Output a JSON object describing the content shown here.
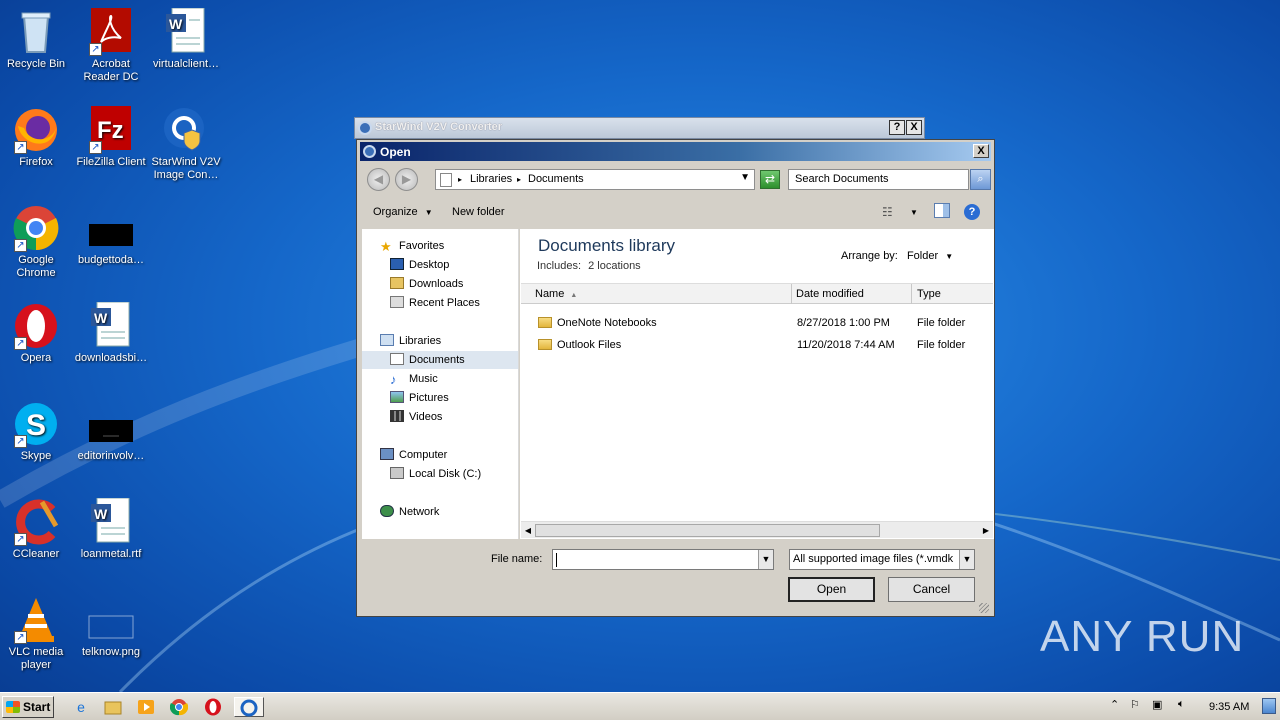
{
  "desktop": {
    "icons": [
      {
        "label": "Recycle Bin",
        "icon": "recycle-bin-icon"
      },
      {
        "label": "Acrobat Reader DC",
        "icon": "acrobat-icon"
      },
      {
        "label": "virtualclient…",
        "icon": "word-doc-icon"
      },
      {
        "label": "Firefox",
        "icon": "firefox-icon"
      },
      {
        "label": "FileZilla Client",
        "icon": "filezilla-icon"
      },
      {
        "label": "StarWind V2V Image Con…",
        "icon": "starwind-icon"
      },
      {
        "label": "Google Chrome",
        "icon": "chrome-icon"
      },
      {
        "label": "budgettoda…",
        "icon": "black-file-icon"
      },
      {
        "label": "Opera",
        "icon": "opera-icon"
      },
      {
        "label": "downloadsbi…",
        "icon": "word-doc-icon"
      },
      {
        "label": "Skype",
        "icon": "skype-icon"
      },
      {
        "label": "editorinvolv…",
        "icon": "black-file-icon"
      },
      {
        "label": "CCleaner",
        "icon": "ccleaner-icon"
      },
      {
        "label": "loanmetal.rtf",
        "icon": "word-doc-icon"
      },
      {
        "label": "VLC media player",
        "icon": "vlc-icon"
      },
      {
        "label": "telknow.png",
        "icon": "png-file-icon"
      }
    ]
  },
  "v2v_window": {
    "title": "StarWind V2V Converter",
    "help_btn": "?",
    "close_btn": "X"
  },
  "dialog": {
    "title": "Open",
    "close_btn": "X",
    "address": {
      "crumbs": [
        "Libraries",
        "Documents"
      ]
    },
    "search_placeholder": "Search Documents",
    "toolbar": {
      "organize": "Organize",
      "new_folder": "New folder"
    },
    "nav": {
      "favorites": "Favorites",
      "desktop": "Desktop",
      "downloads": "Downloads",
      "recent_places": "Recent Places",
      "libraries": "Libraries",
      "documents": "Documents",
      "music": "Music",
      "pictures": "Pictures",
      "videos": "Videos",
      "computer": "Computer",
      "local_disk": "Local Disk (C:)",
      "network": "Network"
    },
    "library": {
      "title": "Documents library",
      "includes_label": "Includes:",
      "includes_link": "2 locations",
      "arrange_label": "Arrange by:",
      "arrange_value": "Folder"
    },
    "columns": {
      "name": "Name",
      "date_modified": "Date modified",
      "type": "Type"
    },
    "rows": [
      {
        "name": "OneNote Notebooks",
        "date": "8/27/2018 1:00 PM",
        "type": "File folder"
      },
      {
        "name": "Outlook Files",
        "date": "11/20/2018 7:44 AM",
        "type": "File folder"
      }
    ],
    "file_name_label": "File name:",
    "file_name_value": "",
    "filter": "All supported image files (*.vmdk",
    "open_btn": "Open",
    "cancel_btn": "Cancel"
  },
  "taskbar": {
    "start": "Start",
    "clock": "9:35 AM"
  },
  "watermark": "ANY RUN"
}
